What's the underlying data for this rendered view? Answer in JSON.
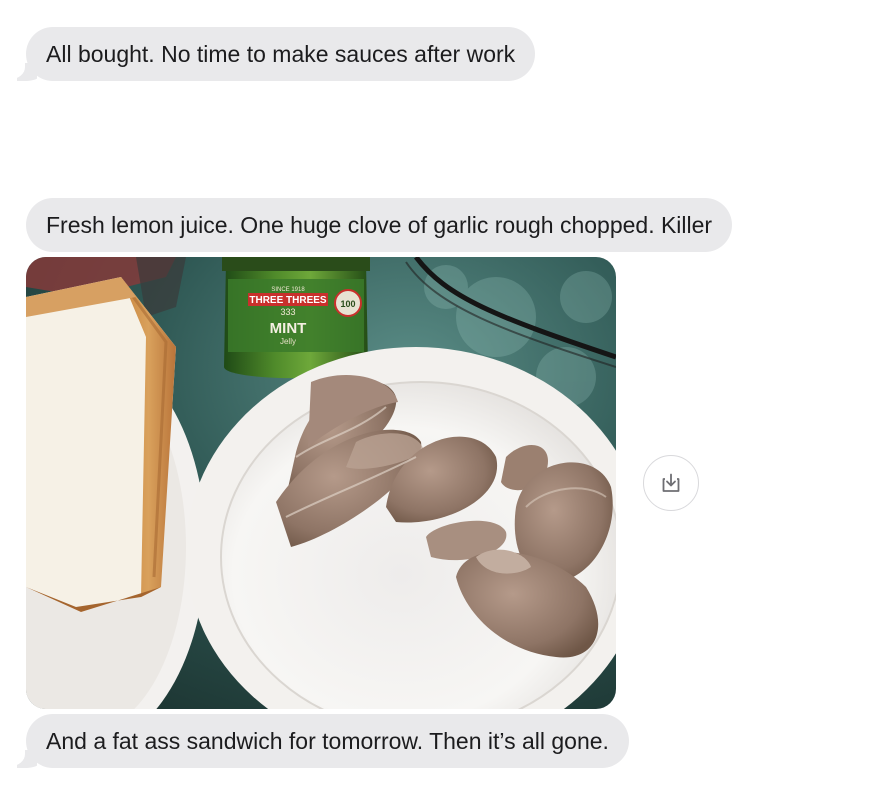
{
  "messages": [
    {
      "text": "All bought. No time to make sauces after work"
    },
    {
      "text": "Fresh lemon juice. One huge clove of garlic rough chopped. Killer"
    },
    {
      "text": "And a fat ass sandwich for tomorrow. Then it’s all gone."
    }
  ],
  "photo": {
    "jar_label_brand": "THREE THREES",
    "jar_label_since": "SINCE 1918",
    "jar_label_product": "MINT",
    "jar_label_type": "Jelly",
    "jar_badge": "100",
    "jar_logo": "333"
  },
  "colors": {
    "bubble_bg": "#e9e9eb",
    "bubble_text": "#1c1c1e",
    "background": "#ffffff"
  },
  "icons": {
    "save": "save-to-downloads-icon"
  }
}
